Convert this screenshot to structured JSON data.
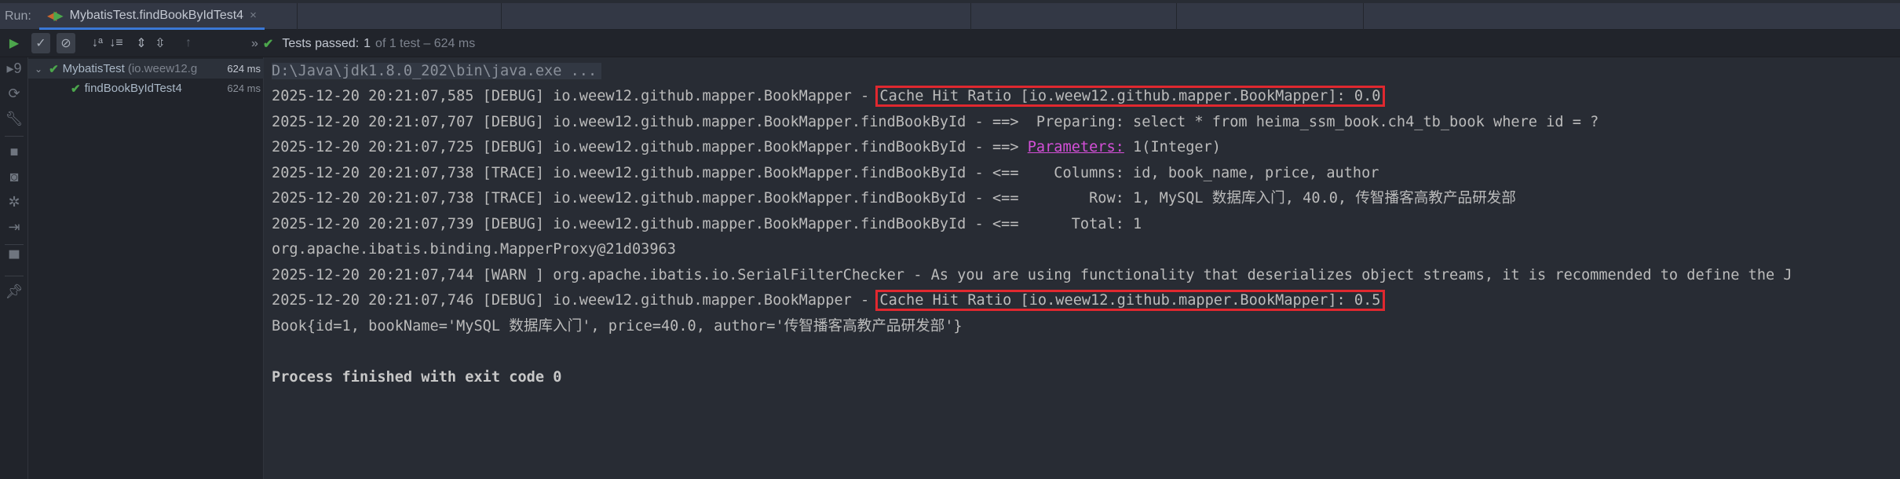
{
  "header": {
    "run_label": "Run:",
    "tab_title": "MybatisTest.findBookByIdTest4",
    "close": "×"
  },
  "toolbar": {
    "status_label": "Tests passed:",
    "status_count": "1",
    "status_rest": "of 1 test – 624 ms",
    "more": "»"
  },
  "tree": [
    {
      "name": "MybatisTest",
      "pkg": "(io.weew12.g",
      "time": "624 ms"
    },
    {
      "name": "findBookByIdTest4",
      "time": "624 ms"
    }
  ],
  "console": {
    "command": "D:\\Java\\jdk1.8.0_202\\bin\\java.exe ...",
    "l1_prefix": "2025-12-20 20:21:07,585 [DEBUG] io.weew12.github.mapper.BookMapper - ",
    "l1_box": "Cache Hit Ratio [io.weew12.github.mapper.BookMapper]: 0.0",
    "l2": "2025-12-20 20:21:07,707 [DEBUG] io.weew12.github.mapper.BookMapper.findBookById - ==>  Preparing: select * from heima_ssm_book.ch4_tb_book where id = ?",
    "l3_prefix": "2025-12-20 20:21:07,725 [DEBUG] io.weew12.github.mapper.BookMapper.findBookById - ==> ",
    "l3_link": "Parameters:",
    "l3_rest": " 1(Integer)",
    "l4": "2025-12-20 20:21:07,738 [TRACE] io.weew12.github.mapper.BookMapper.findBookById - <==    Columns: id, book_name, price, author",
    "l5": "2025-12-20 20:21:07,738 [TRACE] io.weew12.github.mapper.BookMapper.findBookById - <==        Row: 1, MySQL 数据库入门, 40.0, 传智播客高教产品研发部",
    "l6": "2025-12-20 20:21:07,739 [DEBUG] io.weew12.github.mapper.BookMapper.findBookById - <==      Total: 1",
    "l7": "org.apache.ibatis.binding.MapperProxy@21d03963",
    "l8": "2025-12-20 20:21:07,744 [WARN ] org.apache.ibatis.io.SerialFilterChecker - As you are using functionality that deserializes object streams, it is recommended to define the J",
    "l9_prefix": "2025-12-20 20:21:07,746 [DEBUG] io.weew12.github.mapper.BookMapper - ",
    "l9_box": "Cache Hit Ratio [io.weew12.github.mapper.BookMapper]: 0.5",
    "l10": "Book{id=1, bookName='MySQL 数据库入门', price=40.0, author='传智播客高教产品研发部'}",
    "l11": "Process finished with exit code 0"
  }
}
